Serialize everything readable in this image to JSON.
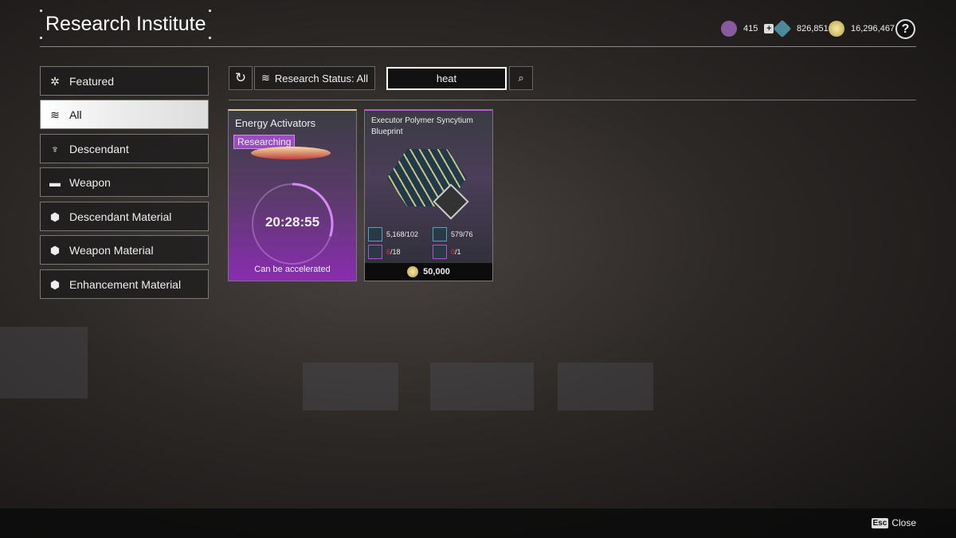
{
  "header": {
    "title": "Research Institute",
    "currencies": [
      {
        "icon": "purple-token-icon",
        "value": "415",
        "color": "#8a5aa0"
      },
      {
        "icon": "kuiper-shard-icon",
        "value": "826,851",
        "color": "#4a8a9a"
      },
      {
        "icon": "gold-coin-icon",
        "value": "16,296,467",
        "color": "#d6c36a"
      }
    ],
    "help": "?"
  },
  "sidebar": {
    "items": [
      {
        "label": "Featured",
        "icon": "star-cluster-icon"
      },
      {
        "label": "All",
        "icon": "layers-icon",
        "active": true
      },
      {
        "label": "Descendant",
        "icon": "descendant-icon"
      },
      {
        "label": "Weapon",
        "icon": "gun-icon"
      },
      {
        "label": "Descendant Material",
        "icon": "descendant-material-icon"
      },
      {
        "label": "Weapon Material",
        "icon": "weapon-material-icon"
      },
      {
        "label": "Enhancement Material",
        "icon": "enhancement-material-icon"
      }
    ]
  },
  "toolbar": {
    "status_label": "Research Status: All",
    "search_value": "heat"
  },
  "cards": [
    {
      "title": "Energy Activators",
      "badge": "Researching",
      "timer": "20:28:55",
      "progress": 0.3,
      "note": "Can be accelerated"
    },
    {
      "title": "Executor Polymer Syncytium Blueprint",
      "materials": [
        {
          "have": "5,168",
          "need": "102"
        },
        {
          "have": "579",
          "need": "76"
        },
        {
          "have": "6",
          "need": "18",
          "insufficient": true
        },
        {
          "have": "0",
          "need": "1",
          "insufficient": true
        }
      ],
      "cost": "50,000"
    }
  ],
  "footer": {
    "key": "Esc",
    "label": "Close"
  }
}
